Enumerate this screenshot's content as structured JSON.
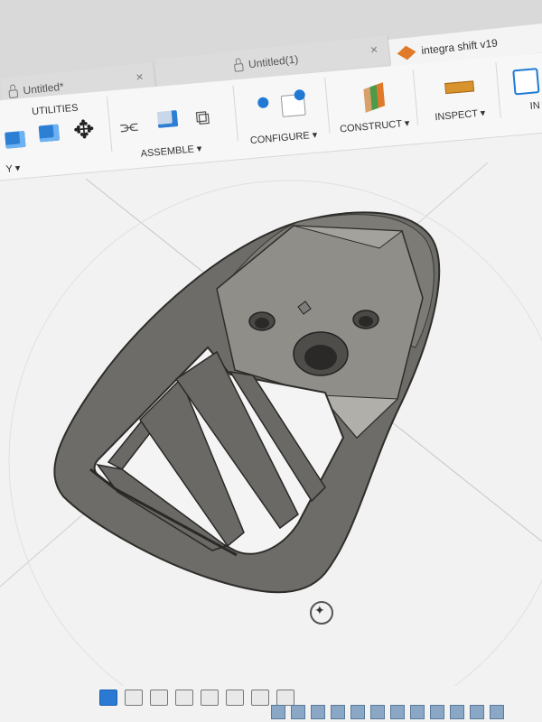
{
  "tabs": [
    {
      "label": "Untitled*",
      "close": "×"
    },
    {
      "label": "Untitled(1)",
      "close": "×"
    },
    {
      "label": "integra shift v19",
      "close": ""
    }
  ],
  "toolbar": {
    "utilities_label": "UTILITIES",
    "left_trunc_label": "Y ▾",
    "assemble_label": "ASSEMBLE ▾",
    "configure_label": "CONFIGURE ▾",
    "construct_label": "CONSTRUCT ▾",
    "inspect_label": "INSPECT ▾",
    "right_trunc_label": "IN"
  },
  "colors": {
    "accent": "#1f7ad6",
    "part_body": "#6b6a66",
    "part_light": "#8f8e89",
    "part_dark": "#3a3936"
  },
  "icons": [
    "lock-icon",
    "cube-icon",
    "move-icon",
    "joint-icon",
    "param-icon",
    "plane-icon",
    "ruler-icon",
    "link-icon",
    "orbit-icon"
  ]
}
